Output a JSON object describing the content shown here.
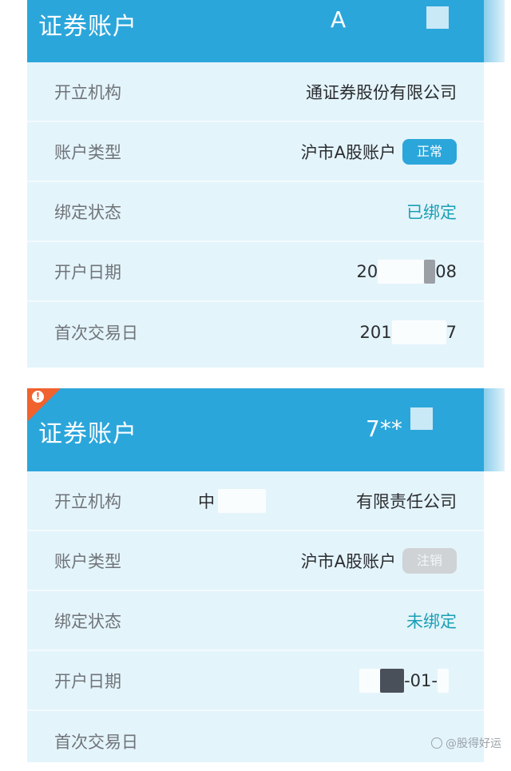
{
  "card1": {
    "title": "证券账户",
    "account_partial": "A",
    "rows": [
      {
        "label": "开立机构",
        "value": "通证券股份有限公司"
      },
      {
        "label": "账户类型",
        "value": "沪市A股账户",
        "badge": "正常"
      },
      {
        "label": "绑定状态",
        "value": "已绑定"
      },
      {
        "label": "开户日期",
        "value_start": "20",
        "value_end": "08"
      },
      {
        "label": "首次交易日",
        "value_start": "201",
        "value_end": "7"
      }
    ]
  },
  "card2": {
    "title": "证券账户",
    "account_partial": "7**",
    "rows": [
      {
        "label": "开立机构",
        "value_left": "中",
        "value": "有限责任公司"
      },
      {
        "label": "账户类型",
        "value": "沪市A股账户",
        "badge": "注销"
      },
      {
        "label": "绑定状态",
        "value": "未绑定"
      },
      {
        "label": "开户日期",
        "value": "-01-"
      },
      {
        "label": "首次交易日",
        "value": ""
      }
    ]
  },
  "watermark": "@股得好运",
  "colors": {
    "header_blue": "#2ba6db",
    "card_bg": "#e4f4fb",
    "teal_text": "#1a9fb5",
    "badge_normal": "#2ba6db",
    "badge_cancel": "#cfd3d6",
    "warning": "#f0622e"
  },
  "icons": {
    "warning": "warning-icon",
    "watermark": "watermark-logo-icon"
  }
}
